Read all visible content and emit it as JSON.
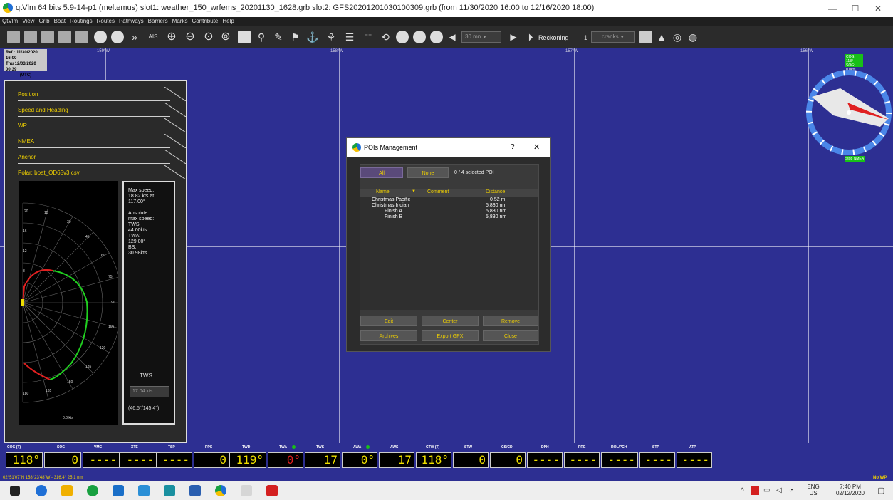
{
  "window": {
    "title": "qtVlm 64 bits 5.9-14-p1 (meltemus) slot1: weather_150_wrfems_20201130_1628.grb slot2: GFS20201201030100309.grb (from 11/30/2020 16:00 to 12/16/2020 18:00)",
    "minimize": "—",
    "maximize": "☐",
    "close": "✕"
  },
  "menu": [
    "QtVlm",
    "View",
    "Grib",
    "Boat",
    "Routings",
    "Routes",
    "Pathways",
    "Barriers",
    "Marks",
    "Contribute",
    "Help"
  ],
  "toolbar": {
    "time_step": "30 mn",
    "reckoning_label": "Reckoning",
    "cranks_count": "1",
    "cranks_label": "cranks"
  },
  "map": {
    "ref_line1": "Ref : 11/30/2020 16:00",
    "ref_line2": "Thu 12/03/2020 00:39",
    "ref_line3": "(UTC)",
    "lon_labels": [
      "159°W",
      "158°W",
      "157°W",
      "156°W"
    ]
  },
  "left_panel": {
    "rows": [
      "Position",
      "Speed and Heading",
      "WP",
      "NMEA",
      "Anchor",
      "Polar: boat_OD65v3.csv"
    ],
    "polar_info": "Max speed:\n18.82 kts at\n117.00°\n\nAbsolute\nmax speed:\nTWS:\n44.00kts\nTWA:\n129.00°\nBS:\n30.98kts",
    "tws_label": "TWS",
    "tws_value": "17.04 kts",
    "angle_range": "(46.5°/145.4°)",
    "polar_speed_label": "0.0 kts",
    "polar_angle_labels": [
      "15",
      "30",
      "45",
      "60",
      "75",
      "90",
      "105",
      "120",
      "135",
      "150",
      "165",
      "180"
    ],
    "polar_speed_ticks": [
      "20",
      "16",
      "12",
      "8",
      "4"
    ]
  },
  "compass": {
    "cog_line1": "COG: 118°",
    "cog_line2": "SOG: 0.0kts",
    "stop_nmea": "Stop NMEA"
  },
  "dialog": {
    "title": "POIs Management",
    "help": "?",
    "close_x": "✕",
    "btn_all": "All",
    "btn_none": "None",
    "selection": "0 / 4 selected POI",
    "columns": [
      "Name",
      "Comment",
      "Distance"
    ],
    "rows": [
      {
        "name": "Christmas Pacific",
        "comment": "",
        "distance": "0.52 m"
      },
      {
        "name": "Christmas Indian",
        "comment": "",
        "distance": "5,830 nm"
      },
      {
        "name": "Finish A",
        "comment": "",
        "distance": "5,830 nm"
      },
      {
        "name": "Finish B",
        "comment": "",
        "distance": "5,830 nm"
      }
    ],
    "btn_edit": "Edit",
    "btn_center": "Center",
    "btn_remove": "Remove",
    "btn_archives": "Archives",
    "btn_export": "Export GPX",
    "btn_close": "Close"
  },
  "instruments": [
    {
      "label": "COG (T)",
      "value": "118°"
    },
    {
      "label": "SOG",
      "value": "0"
    },
    {
      "label": "VMC",
      "value": "----"
    },
    {
      "label": "XTE",
      "value": "----"
    },
    {
      "label": "TSP",
      "value": "----"
    },
    {
      "label": "PPC",
      "value": "0"
    },
    {
      "label": "TWD",
      "value": "119°"
    },
    {
      "label": "TWA",
      "value": "0°"
    },
    {
      "label": "TWS",
      "value": "17"
    },
    {
      "label": "AWA",
      "value": "0°"
    },
    {
      "label": "AWS",
      "value": "17"
    },
    {
      "label": "CTW (T)",
      "value": "118°"
    },
    {
      "label": "STW",
      "value": "0"
    },
    {
      "label": "CS/CD",
      "value": "0"
    },
    {
      "label": "DPH",
      "value": "----"
    },
    {
      "label": "PRE",
      "value": "----"
    },
    {
      "label": "ROL/PCH",
      "value": "----"
    },
    {
      "label": "STP",
      "value": "----"
    },
    {
      "label": "ATP",
      "value": "----"
    }
  ],
  "status": {
    "position": "02°51'07\"N 158°23'48\"W - 316.4° 25.1 nm",
    "no_wp": "No WP"
  },
  "taskbar": {
    "lang1": "ENG",
    "lang2": "US",
    "time": "7:40 PM",
    "date": "02/12/2020"
  },
  "colors": {
    "map_bg": "#2d2f92",
    "accent_yellow": "#f0d000",
    "ok_green": "#18c018",
    "twa_red": "#e02020"
  }
}
